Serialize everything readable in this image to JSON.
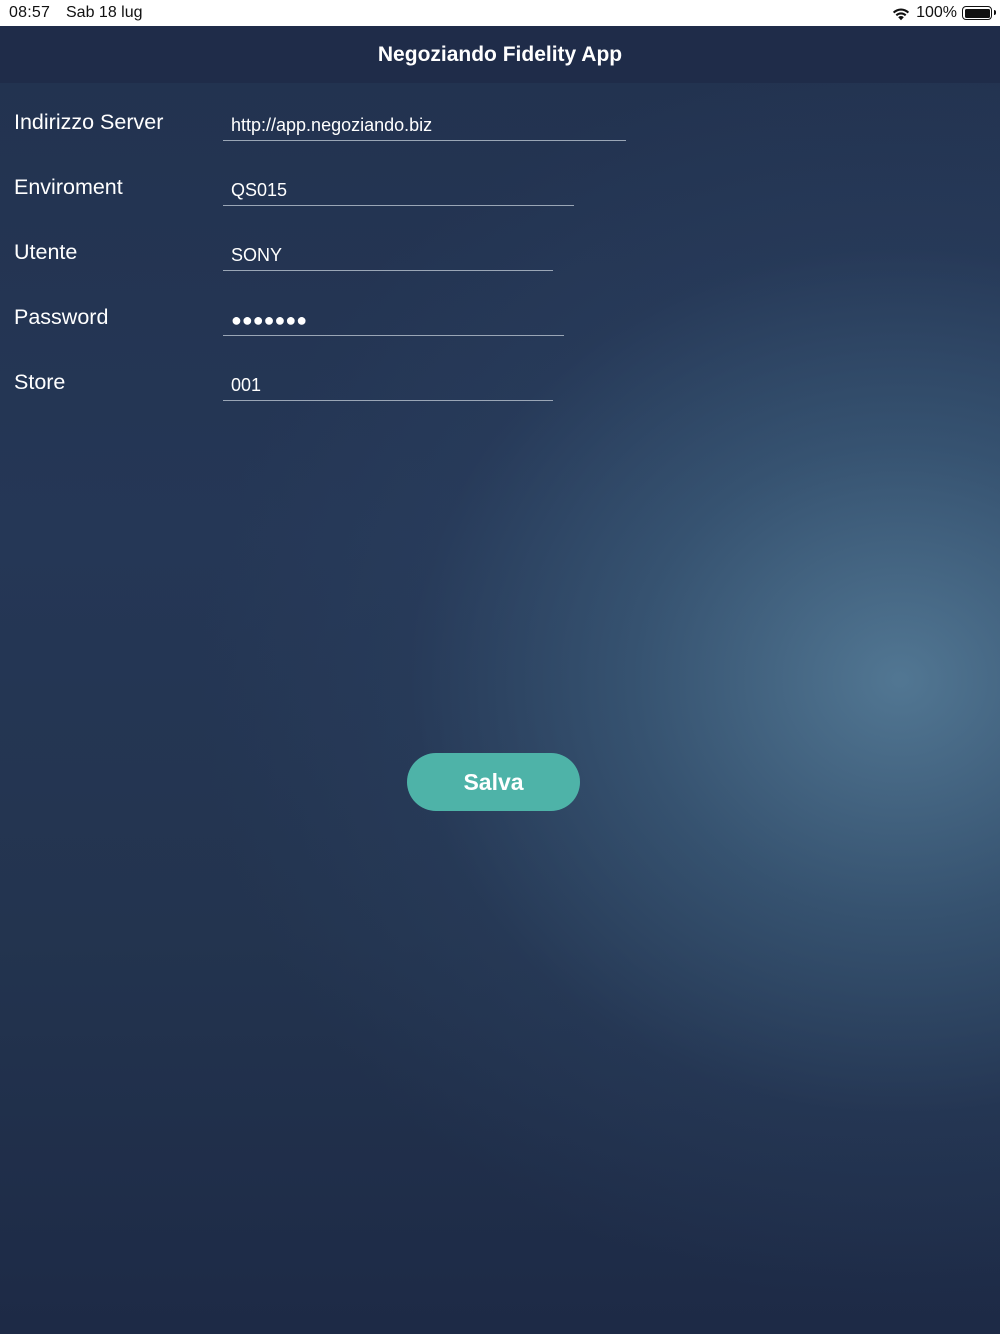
{
  "status_bar": {
    "time": "08:57",
    "date": "Sab 18 lug",
    "battery": "100%",
    "icons": [
      "wifi-icon",
      "battery-icon"
    ]
  },
  "nav": {
    "title": "Negoziando Fidelity App"
  },
  "form": {
    "server": {
      "label": "Indirizzo Server",
      "value": "http://app.negoziando.biz"
    },
    "environment": {
      "label": "Enviroment",
      "value": "QS015"
    },
    "user": {
      "label": "Utente",
      "value": "SONY"
    },
    "password": {
      "label": "Password",
      "value": "●●●●●●●"
    },
    "store": {
      "label": "Store",
      "value": "001"
    }
  },
  "actions": {
    "save_label": "Salva"
  },
  "colors": {
    "accent": "#4eb3a8",
    "nav_background": "#1f2c49",
    "background_dark": "#1d2a46",
    "background_light": "#4b6d88"
  }
}
